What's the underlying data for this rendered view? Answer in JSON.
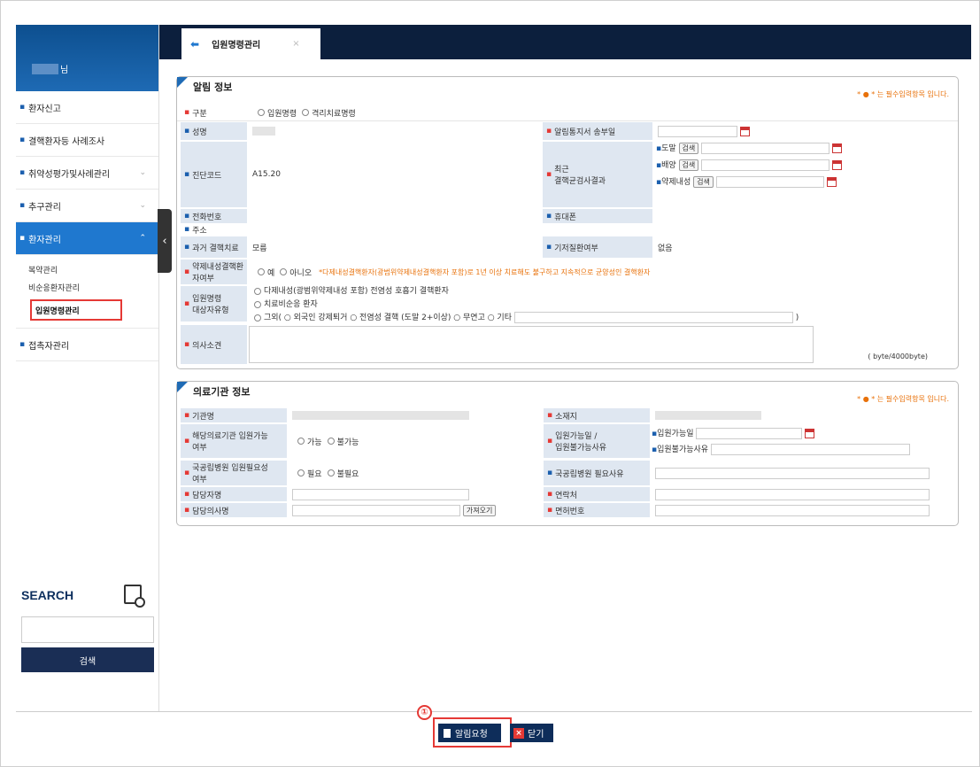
{
  "user": {
    "suffix": "님"
  },
  "menu": [
    {
      "label": "환자신고"
    },
    {
      "label": "결핵환자등 사례조사"
    },
    {
      "label": "취약성평가및사례관리"
    },
    {
      "label": "추구관리"
    },
    {
      "label": "환자관리"
    },
    {
      "label": "접촉자관리"
    }
  ],
  "submenu": [
    "복약관리",
    "비순응환자관리",
    "입원명령관리"
  ],
  "search": {
    "title": "SEARCH",
    "button": "검색"
  },
  "tab": {
    "label": "입원명령관리",
    "close": "×"
  },
  "section1": {
    "title": "알림 정보",
    "req_note": "* ● * 는 필수입력항목 입니다.",
    "gubun_label": "구분",
    "gubun_opts": [
      "입원명령",
      "격리치료명령"
    ],
    "name_label": "성명",
    "notice_date_label": "알림통지서 송부일",
    "diag_label": "진단코드",
    "diag_value": "A15.20",
    "recent_label": "최근\n결핵균검사결과",
    "recent_items": [
      "도말",
      "배양",
      "약제내성"
    ],
    "search_btn": "검색",
    "phone_label": "전화번호",
    "mobile_label": "휴대폰",
    "addr_label": "주소",
    "hist_label": "과거 결핵치료",
    "hist_value": "모름",
    "existing_label": "기저질환여부",
    "existing_value": "없음",
    "resist_label": "약제내성결핵환자여부",
    "resist_opts": [
      "예",
      "아니오"
    ],
    "resist_note": "*다제내성결핵환자(광범위약제내성결핵환자 포함)로 1년 이상 치료해도 불구하고 지속적으로 균양성인 결핵환자",
    "target_label": "입원명령\n대상자유형",
    "target_opts": [
      "다제내성(광범위약제내성 포함) 전염성 호흡기 결핵환자",
      "치료비순응 환자"
    ],
    "target_other": "그외( ○ 외국인 강제퇴거 ○ 전염성 결핵 (도말 2+이상) ○ 무연고 ○ 기타",
    "opinion_label": "의사소견",
    "byte_note": "( byte/4000byte)"
  },
  "section2": {
    "title": "의료기관 정보",
    "req_note": "* ● * 는 필수입력항목 입니다.",
    "inst_label": "기관명",
    "loc_label": "소재지",
    "avail_label": "해당의료기관 입원가능\n여부",
    "avail_opts": [
      "가능",
      "불가능"
    ],
    "admit_label": "입원가능일 /\n입원불가능사유",
    "admit_date_label": "입원가능일",
    "admit_reason_label": "입원불가능사유",
    "national_label": "국공립병원 입원필요성\n여부",
    "national_opts": [
      "필요",
      "불필요"
    ],
    "national_reason_label": "국공립병원 필요사유",
    "manager_label": "담당자명",
    "contact_label": "연락처",
    "doctor_label": "담당의사명",
    "fetch_btn": "가져오기",
    "license_label": "면허번호"
  },
  "buttons": {
    "request": "알림요청",
    "close": "닫기",
    "marker": "①"
  }
}
